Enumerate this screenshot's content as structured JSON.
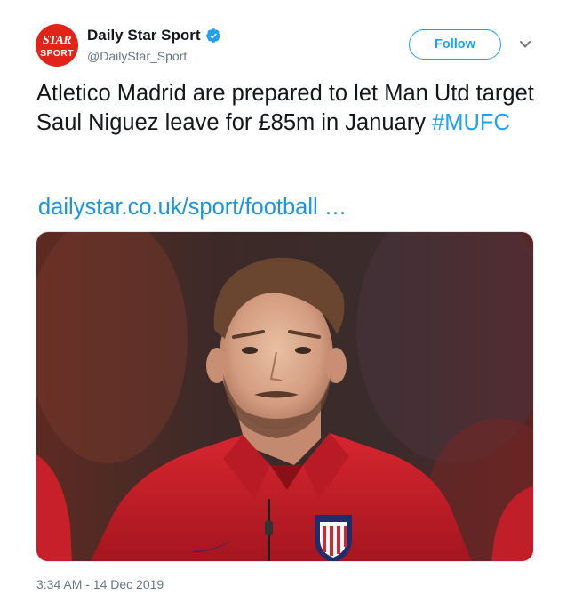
{
  "account": {
    "avatar_line1": "STAR",
    "avatar_line2": "SPORT",
    "display_name": "Daily Star Sport",
    "handle": "@DailyStar_Sport",
    "verified": true
  },
  "actions": {
    "follow_label": "Follow",
    "menu_icon": "chevron-down-icon"
  },
  "tweet": {
    "text": "Atletico Madrid are prepared to let Man Utd target Saul Niguez leave for £85m in January",
    "hashtag": "#MUFC",
    "link_text": "dailystar.co.uk/sport/football …"
  },
  "media": {
    "type": "photo",
    "description_icon": "player-photo"
  },
  "timestamp": "3:34 AM - 14 Dec 2019",
  "colors": {
    "brand_red": "#e2231a",
    "link_blue": "#1da1f2",
    "secondary_text": "#657786",
    "kit_red": "#d11f2a"
  }
}
